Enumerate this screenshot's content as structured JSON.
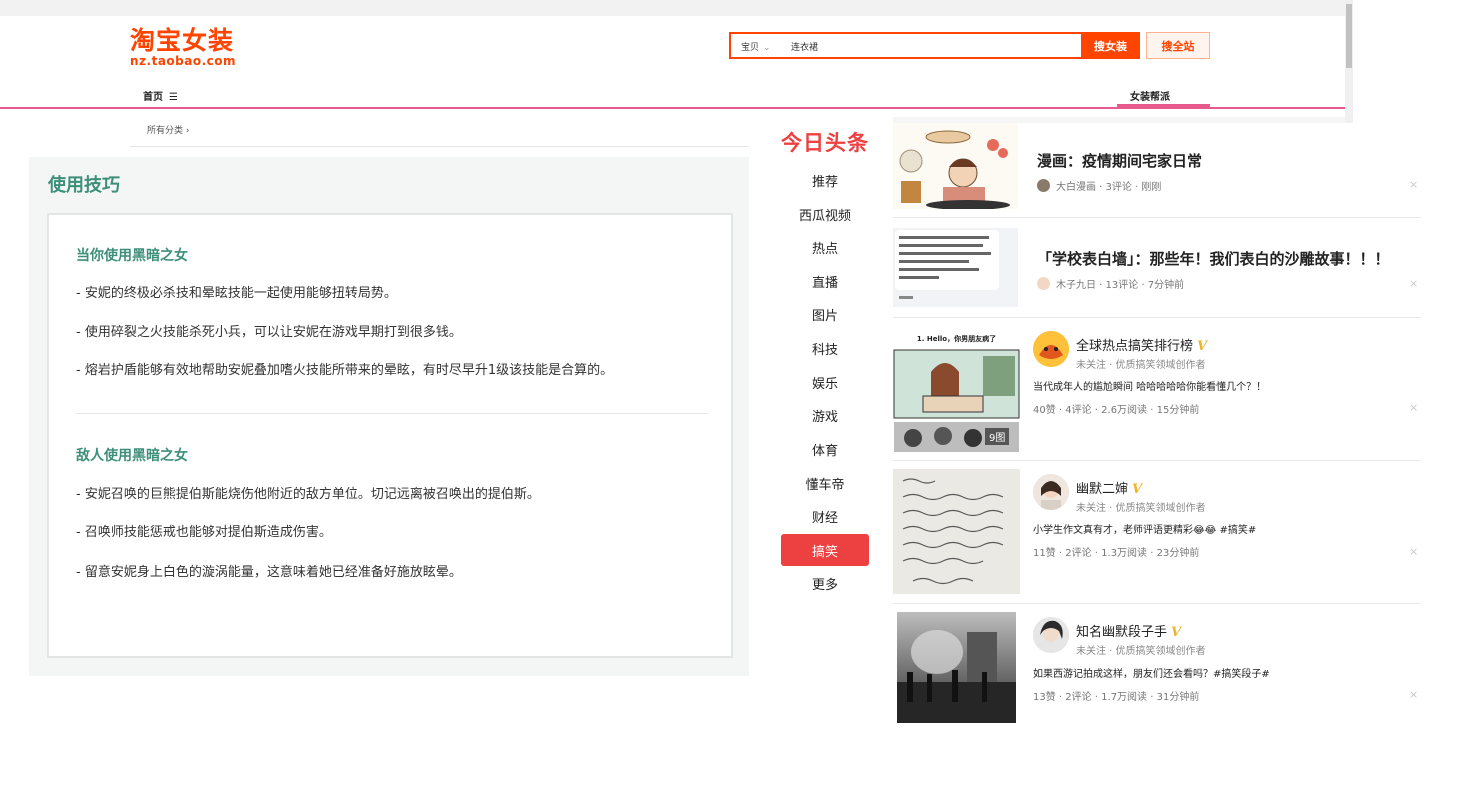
{
  "taobao": {
    "logo_cn": "淘宝女装",
    "logo_en": "nz.taobao.com",
    "search_scope": "宝贝",
    "search_value": "连衣裙",
    "search_button": "搜女装",
    "search_all_button": "搜全站",
    "nav_home": "首页",
    "nav_help": "女装帮派",
    "breadcrumb": "所有分类",
    "breadcrumb_arrow": "›"
  },
  "tips": {
    "title": "使用技巧",
    "sections": [
      {
        "heading": "当你使用黑暗之女",
        "items": [
          "- 安妮的终极必杀技和晕眩技能一起使用能够扭转局势。",
          "- 使用碎裂之火技能杀死小兵，可以让安妮在游戏早期打到很多钱。",
          "- 熔岩护盾能够有效地帮助安妮叠加嗜火技能所带来的晕眩，有时尽早升1级该技能是合算的。"
        ]
      },
      {
        "heading": "敌人使用黑暗之女",
        "items": [
          "- 安妮召唤的巨熊提伯斯能烧伤他附近的敌方单位。切记远离被召唤出的提伯斯。",
          "- 召唤师技能惩戒也能够对提伯斯造成伤害。",
          "- 留意安妮身上白色的漩涡能量，这意味着她已经准备好施放眩晕。"
        ]
      }
    ]
  },
  "toutiao": {
    "logo": "今日头条",
    "nav": [
      "推荐",
      "西瓜视频",
      "热点",
      "直播",
      "图片",
      "科技",
      "娱乐",
      "游戏",
      "体育",
      "懂车帝",
      "财经",
      "搞笑",
      "更多"
    ],
    "active_nav": "搞笑",
    "close_glyph": "×",
    "feed": [
      {
        "title": "漫画：疫情期间宅家日常",
        "meta": "大白漫画 · 3评论 · 刚刚"
      },
      {
        "title": "「学校表白墙」：那些年！我们表白的沙雕故事！！！",
        "meta": "木子九日 · 13评论 · 7分钟前"
      },
      {
        "author": "全球热点搞笑排行榜",
        "badge": "V",
        "sub": "未关注 · 优质搞笑领域创作者",
        "text": "当代成年人的尴尬瞬间 哈哈哈哈哈你能看懂几个？！",
        "meta": "40赞 · 4评论 · 2.6万阅读 · 15分钟前",
        "image_count": "9图",
        "thumb_caption": "1. Hello，你男朋友病了"
      },
      {
        "author": "幽默二婶",
        "badge": "V",
        "sub": "未关注 · 优质搞笑领域创作者",
        "text": "小学生作文真有才，老师评语更精彩😂😂 #搞笑#",
        "meta": "11赞 · 2评论 · 1.3万阅读 · 23分钟前"
      },
      {
        "author": "知名幽默段子手",
        "badge": "V",
        "sub": "未关注 · 优质搞笑领域创作者",
        "text": "如果西游记拍成这样，朋友们还会看吗？#搞笑段子#",
        "meta": "13赞 · 2评论 · 1.7万阅读 · 31分钟前"
      }
    ]
  }
}
